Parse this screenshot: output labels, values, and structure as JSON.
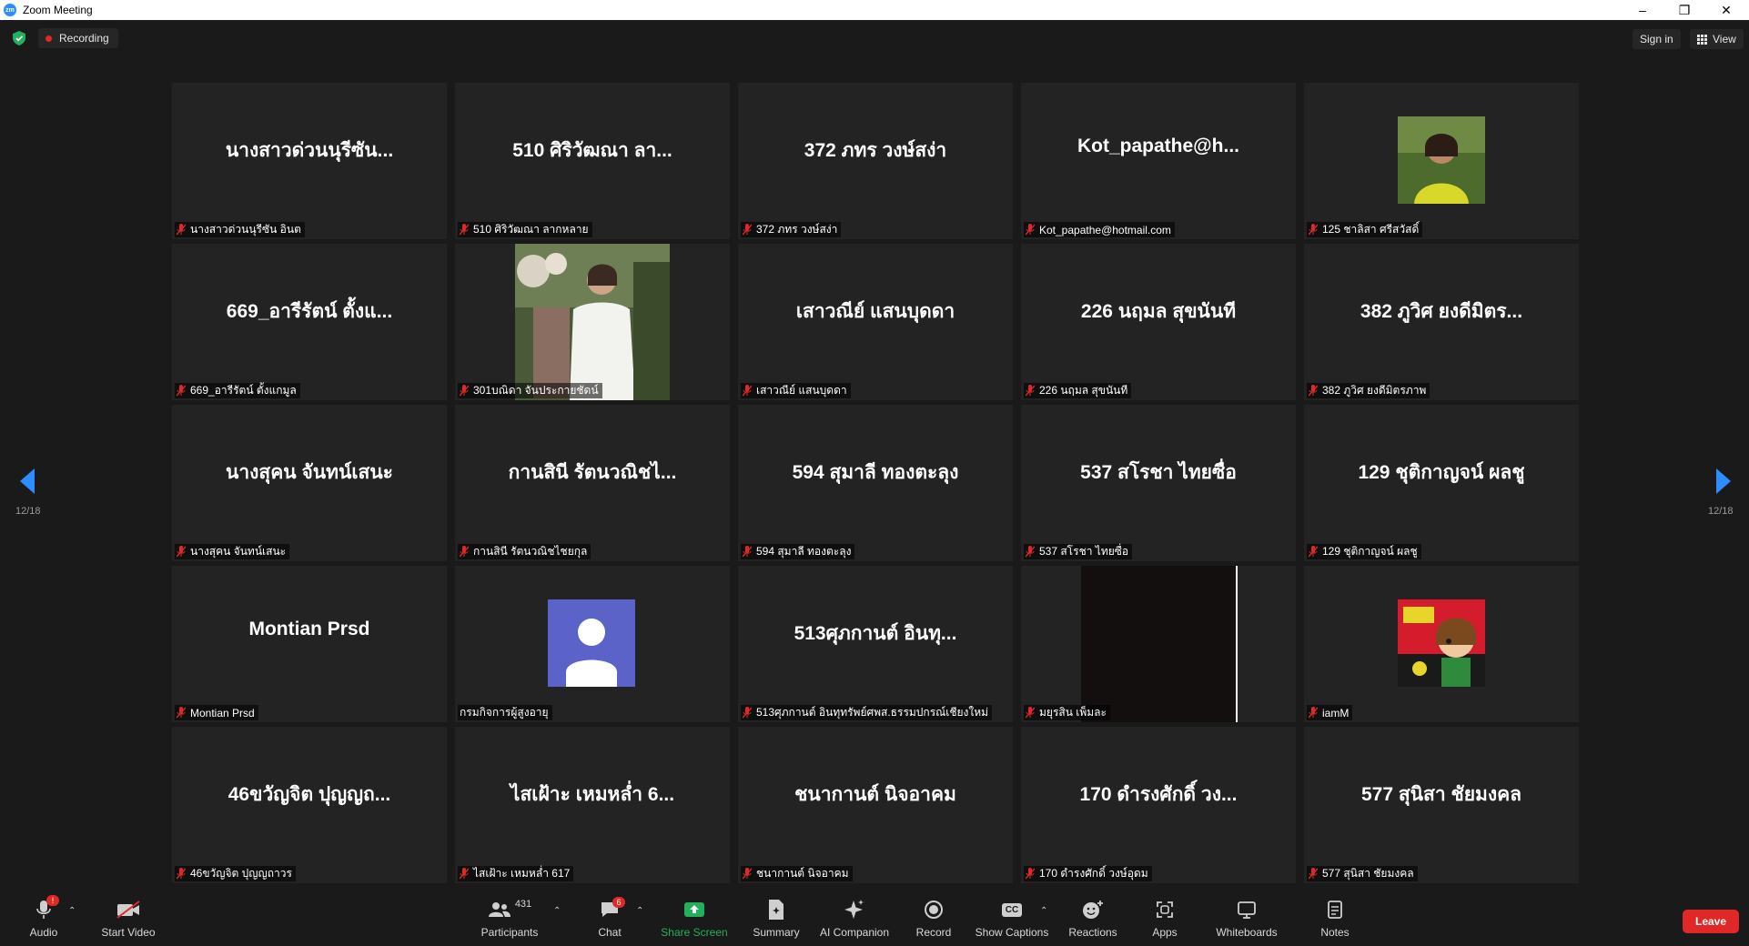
{
  "window": {
    "title": "Zoom Meeting",
    "logo_text": "zm"
  },
  "topbar": {
    "recording_label": "Recording",
    "signin_label": "Sign in",
    "view_label": "View"
  },
  "pagination": {
    "left": "12/18",
    "right": "12/18"
  },
  "tiles": [
    {
      "name": "นางสาวด่วนนุรีซัน...",
      "label": "นางสาวด่วนนุรีซัน อินต"
    },
    {
      "name": "510 ศิริวัฒณา ลา...",
      "label": "510 ศิริวัฒณา ลากหลาย"
    },
    {
      "name": "372 ภทร วงษ์สง่า",
      "label": "372 ภทร วงษ์สง่า"
    },
    {
      "name": "Kot_papathe@h...",
      "label": "Kot_papathe@hotmail.com"
    },
    {
      "name": "",
      "label": "125 ชาลิสา ศรีสวัสดิ์"
    },
    {
      "name": "669_อารีรัตน์ ตั้งแ...",
      "label": "669_อารีรัตน์ ตั้งแกมูล"
    },
    {
      "name": "",
      "label": "301บณิดา จันประกายชัดน์"
    },
    {
      "name": "เสาวณีย์ แสนบุดดา",
      "label": "เสาวณีย์ แสนบุดดา"
    },
    {
      "name": "226 นฤมล สุขนันที",
      "label": "226 นฤมล สุขนันที"
    },
    {
      "name": "382 ภูวิศ ยงดีมิตร...",
      "label": "382 ภูวิศ ยงดีมิตรภาพ"
    },
    {
      "name": "นางสุคน จันทน์เสนะ",
      "label": "นางสุคน จันทน์เสนะ"
    },
    {
      "name": "กานสินี รัตนวณิชไ...",
      "label": "กานสินี รัตนวณิชไชยกุล"
    },
    {
      "name": "594 สุมาลี ทองตะลุง",
      "label": "594 สุมาลี ทองตะลุง"
    },
    {
      "name": "537 สโรชา ไทยซื่อ",
      "label": "537 สโรชา ไทยซื่อ"
    },
    {
      "name": "129 ชุติกาญจน์ ผลชู",
      "label": "129 ชุติกาญจน์ ผลชู"
    },
    {
      "name": "Montian Prsd",
      "label": "Montian Prsd"
    },
    {
      "name": "",
      "label": "กรมกิจการผู้สูงอายุ"
    },
    {
      "name": "513ศุภกานต์ อินทุ...",
      "label": "513ศุภกานต์ อินทุทรัพย์ศพส.ธรรมปกรณ์เชียงใหม่"
    },
    {
      "name": "",
      "label": "มยุรสิน เพ็มละ"
    },
    {
      "name": "",
      "label": "iamM"
    },
    {
      "name": "46ขวัญจิต ปุญญถ...",
      "label": "46ขวัญจิต ปุญญถาวร"
    },
    {
      "name": "ไสเฝ้าะ เหมหล่ำ 6...",
      "label": "ไสเฝ้าะ เหมหล่ำ 617"
    },
    {
      "name": "ชนากานต์ นิจอาคม",
      "label": "ชนากานต์ นิจอาคม"
    },
    {
      "name": "170 ดำรงศักดิ์ วง...",
      "label": "170 ดำรงศักดิ์ วงษ์อุดม"
    },
    {
      "name": "577 สุนิสา ชัยมงคล",
      "label": "577 สุนิสา ชัยมงคล"
    }
  ],
  "toolbar": {
    "audio": "Audio",
    "audio_badge": "!",
    "start_video": "Start Video",
    "participants": "Participants",
    "participants_count": "431",
    "chat": "Chat",
    "chat_badge": "6",
    "share_screen": "Share Screen",
    "summary": "Summary",
    "ai_companion": "AI Companion",
    "record": "Record",
    "show_captions": "Show Captions",
    "captions_icon_text": "CC",
    "reactions": "Reactions",
    "apps": "Apps",
    "whiteboards": "Whiteboards",
    "notes": "Notes",
    "leave": "Leave"
  },
  "colors": {
    "accent": "#2d8cff",
    "leave": "#e02828",
    "share": "#23b05c",
    "mute": "#e02828"
  }
}
